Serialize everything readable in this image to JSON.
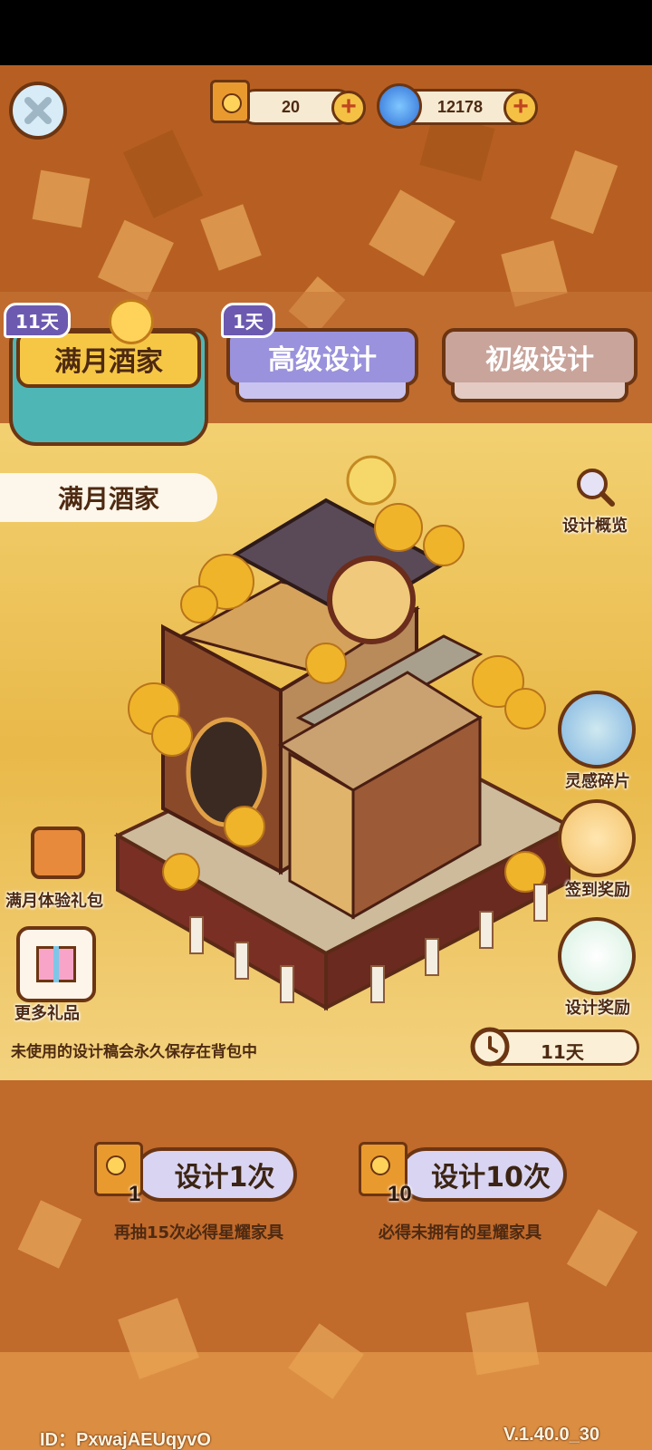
{
  "resources": {
    "design_ticket": {
      "value": "20",
      "icon": "design-scroll-icon"
    },
    "star_currency": {
      "value": "12178",
      "icon": "blue-swirl-icon"
    }
  },
  "tabs": [
    {
      "label": "满月酒家",
      "badge": "11天",
      "active": true
    },
    {
      "label": "高级设计",
      "badge": "1天",
      "active": false
    },
    {
      "label": "初级设计",
      "badge": "",
      "active": false
    }
  ],
  "scene_title": "满月酒家",
  "right_actions": {
    "overview": "设计概览",
    "inspiration": "灵感碎片",
    "signin": "签到奖励",
    "design_reward": "设计奖励"
  },
  "left_actions": {
    "trial_pack": "满月体验礼包",
    "more_gifts": "更多礼品"
  },
  "notice": "未使用的设计稿会永久保存在背包中",
  "timer": "11天",
  "draw": {
    "single": {
      "label": "设计1次",
      "cost": "1",
      "note": "再抽15次必得星耀家具"
    },
    "ten": {
      "label": "设计10次",
      "cost": "10",
      "note": "必得未拥有的星耀家具"
    }
  },
  "footer": {
    "id_label": "ID：",
    "id_value": "PxwajAEUqyvO",
    "version": "V.1.40.0_30"
  },
  "colors": {
    "brown_outline": "#6c3512",
    "top_band": "#b75f22",
    "gold": "#e9b949",
    "tab_active": "#f6c745",
    "tab_advanced": "#9a92dc",
    "tab_basic": "#c9a49b"
  }
}
